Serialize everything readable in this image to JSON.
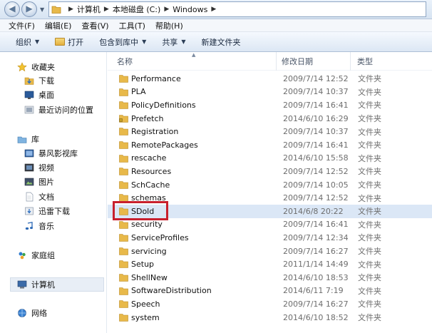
{
  "address_bar": {
    "crumbs": [
      "计算机",
      "本地磁盘 (C:)",
      "Windows"
    ]
  },
  "menu": [
    "文件(F)",
    "编辑(E)",
    "查看(V)",
    "工具(T)",
    "帮助(H)"
  ],
  "toolbar": {
    "organize": "组织",
    "open": "打开",
    "include_in_library": "包含到库中",
    "share": "共享",
    "new_folder": "新建文件夹"
  },
  "nav": {
    "favorites": "收藏夹",
    "favorites_items": [
      "下载",
      "桌面",
      "最近访问的位置"
    ],
    "libraries": "库",
    "libraries_items": [
      "暴风影视库",
      "视频",
      "图片",
      "文档",
      "迅雷下载",
      "音乐"
    ],
    "homegroup": "家庭组",
    "computer": "计算机",
    "network": "网络"
  },
  "columns": {
    "name": "名称",
    "date": "修改日期",
    "type": "类型"
  },
  "files": [
    {
      "name": "Performance",
      "date": "2009/7/14 12:52",
      "type": "文件夹",
      "locked": false
    },
    {
      "name": "PLA",
      "date": "2009/7/14 10:37",
      "type": "文件夹",
      "locked": false
    },
    {
      "name": "PolicyDefinitions",
      "date": "2009/7/14 16:41",
      "type": "文件夹",
      "locked": false
    },
    {
      "name": "Prefetch",
      "date": "2014/6/10 16:29",
      "type": "文件夹",
      "locked": true
    },
    {
      "name": "Registration",
      "date": "2009/7/14 10:37",
      "type": "文件夹",
      "locked": false
    },
    {
      "name": "RemotePackages",
      "date": "2009/7/14 16:41",
      "type": "文件夹",
      "locked": false
    },
    {
      "name": "rescache",
      "date": "2014/6/10 15:58",
      "type": "文件夹",
      "locked": false
    },
    {
      "name": "Resources",
      "date": "2009/7/14 12:52",
      "type": "文件夹",
      "locked": false
    },
    {
      "name": "SchCache",
      "date": "2009/7/14 10:05",
      "type": "文件夹",
      "locked": false
    },
    {
      "name": "schemas",
      "date": "2009/7/14 12:52",
      "type": "文件夹",
      "locked": false
    },
    {
      "name": "SDold",
      "date": "2014/6/8 20:22",
      "type": "文件夹",
      "locked": false
    },
    {
      "name": "security",
      "date": "2009/7/14 16:41",
      "type": "文件夹",
      "locked": false
    },
    {
      "name": "ServiceProfiles",
      "date": "2009/7/14 12:34",
      "type": "文件夹",
      "locked": false
    },
    {
      "name": "servicing",
      "date": "2009/7/14 16:27",
      "type": "文件夹",
      "locked": false
    },
    {
      "name": "Setup",
      "date": "2011/1/14 14:49",
      "type": "文件夹",
      "locked": false
    },
    {
      "name": "ShellNew",
      "date": "2014/6/10 18:53",
      "type": "文件夹",
      "locked": false
    },
    {
      "name": "SoftwareDistribution",
      "date": "2014/6/11 7:19",
      "type": "文件夹",
      "locked": false
    },
    {
      "name": "Speech",
      "date": "2009/7/14 16:27",
      "type": "文件夹",
      "locked": false
    },
    {
      "name": "system",
      "date": "2014/6/10 18:52",
      "type": "文件夹",
      "locked": false
    }
  ],
  "selected_file": "SDold",
  "colors": {
    "highlight_border": "#c8202d",
    "selected_row": "#dbe7f6",
    "folder": "#e8b94a"
  }
}
